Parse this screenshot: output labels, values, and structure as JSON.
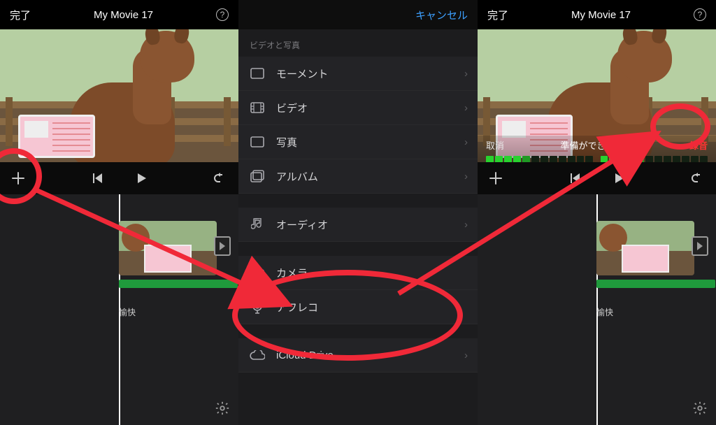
{
  "left": {
    "done": "完了",
    "title": "My Movie 17",
    "clip_label": "愉快"
  },
  "mid": {
    "cancel": "キャンセル",
    "section_media": "ビデオと写真",
    "items_media": [
      "モーメント",
      "ビデオ",
      "写真",
      "アルバム"
    ],
    "item_audio": "オーディオ",
    "item_camera": "カメラ",
    "item_afreco": "アフレコ",
    "item_icloud": "iCloud Drive"
  },
  "right": {
    "done": "完了",
    "title": "My Movie 17",
    "cancel": "取消",
    "ready": "準備ができました",
    "record": "録音",
    "clip_label": "愉快"
  }
}
